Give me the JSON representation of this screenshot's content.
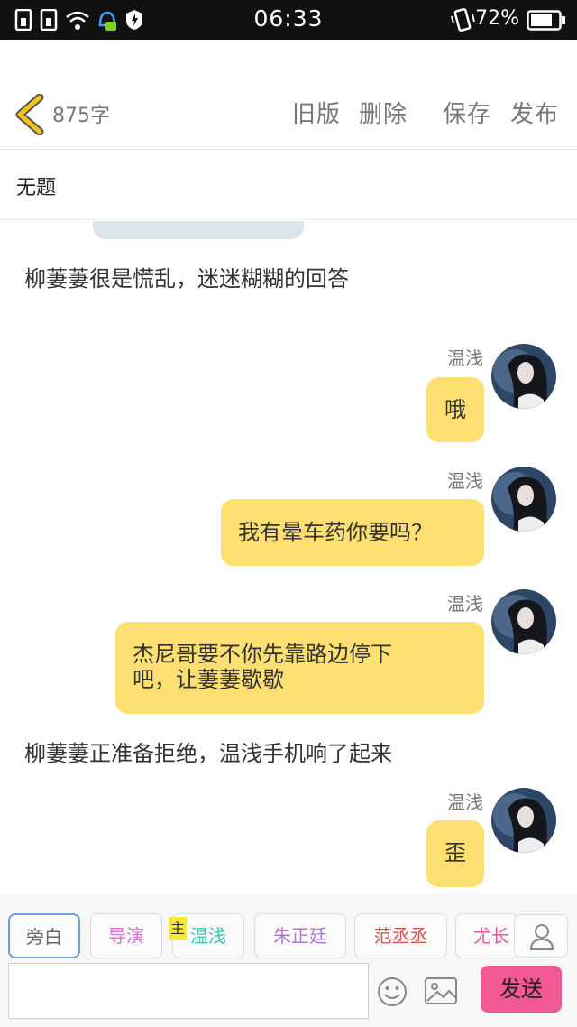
{
  "status_bar": {
    "time": "06:33",
    "battery": "72%"
  },
  "toolbar": {
    "word_count": "875字",
    "old_version": "旧版",
    "delete": "删除",
    "save": "保存",
    "publish": "发布"
  },
  "title": "无题",
  "messages": [
    {
      "type": "narration",
      "text": "柳萋萋很是慌乱，迷迷糊糊的回答"
    },
    {
      "type": "chat",
      "name": "温浅",
      "text": "哦"
    },
    {
      "type": "chat",
      "name": "温浅",
      "text": "我有晕车药你要吗？"
    },
    {
      "type": "chat",
      "name": "温浅",
      "text_line1": "杰尼哥要不你先靠路边停下",
      "text_line2": "吧，让萋萋歇歇"
    },
    {
      "type": "narration",
      "text": "柳萋萋正准备拒绝，温浅手机响了起来"
    },
    {
      "type": "chat",
      "name": "温浅",
      "text": "歪"
    }
  ],
  "characters": [
    {
      "name": "旁白",
      "color": "#666666"
    },
    {
      "name": "导演",
      "color": "#e56bd6"
    },
    {
      "name": "温浅",
      "color": "#3fc2b8"
    },
    {
      "name": "朱正廷",
      "color": "#b07ad1"
    },
    {
      "name": "范丞丞",
      "color": "#d9534f"
    },
    {
      "name": "尤长",
      "color": "#e25ca0"
    }
  ],
  "main_badge": "主",
  "input": {
    "value": "",
    "placeholder": ""
  },
  "send_label": "发送",
  "colors": {
    "bubble": "#fde071",
    "send": "#f25994",
    "active_tab": "#6b9be0",
    "back_icon": "#f0c419"
  }
}
